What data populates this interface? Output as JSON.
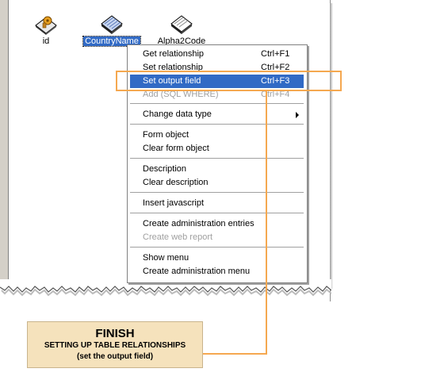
{
  "fields": [
    {
      "label": "id",
      "icon": "key-table-icon",
      "selected": false
    },
    {
      "label": "CountryName",
      "icon": "table-field-icon",
      "selected": true
    },
    {
      "label": "Alpha2Code",
      "icon": "table-field-icon",
      "selected": false
    }
  ],
  "menu": {
    "items": [
      {
        "label": "Get relationship",
        "shortcut": "Ctrl+F1"
      },
      {
        "label": "Set relationship",
        "shortcut": "Ctrl+F2"
      },
      {
        "label": "Set output field",
        "shortcut": "Ctrl+F3",
        "highlighted": true
      },
      {
        "label": "Add (SQL WHERE)",
        "shortcut": "Ctrl+F4",
        "disabled": true
      },
      {
        "label": "Change data type",
        "submenu": true
      },
      {
        "label": "Form object"
      },
      {
        "label": "Clear form object"
      },
      {
        "label": "Description"
      },
      {
        "label": "Clear description"
      },
      {
        "label": "Insert javascript"
      },
      {
        "label": "Create administration entries"
      },
      {
        "label": "Create web report",
        "disabled": true
      },
      {
        "label": "Show menu"
      },
      {
        "label": "Create administration menu"
      }
    ]
  },
  "callout": {
    "title": "FINISH",
    "subtitle": "SETTING UP TABLE RELATIONSHIPS",
    "note": "(set the output field)"
  },
  "colors": {
    "highlight": "#316ac5",
    "orange": "#f5a850",
    "callout_bg": "#f5e2bc"
  }
}
